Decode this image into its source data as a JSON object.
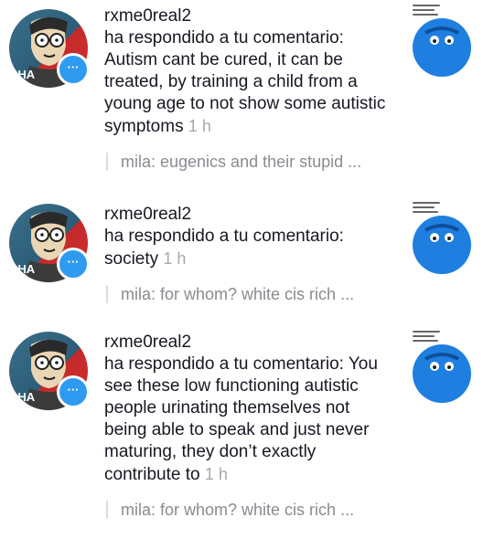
{
  "notifications": [
    {
      "username": "rxme0real2",
      "message": "ha respondido a tu comentario: Autism cant be cured, it can be treated, by training a child from a young age to not show some autistic symptoms",
      "time": "1 h",
      "reply_preview": "mila: eugenics and their stupid ...",
      "badge_icon": "comment-bubble-icon",
      "avatar_text": "CHA"
    },
    {
      "username": "rxme0real2",
      "message": "ha respondido a tu comentario: society",
      "time": "1 h",
      "reply_preview": "mila: for whom? white cis rich ...",
      "badge_icon": "comment-bubble-icon",
      "avatar_text": "CHA"
    },
    {
      "username": "rxme0real2",
      "message": "ha respondido a tu comentario: You see these low functioning autistic people urinating themselves not being able to speak and just never maturing, they don’t exactly contribute to",
      "time": "1 h",
      "reply_preview": "mila: for whom? white cis rich ...",
      "badge_icon": "comment-bubble-icon",
      "avatar_text": "CHA"
    }
  ],
  "colors": {
    "badge": "#2f9bf0",
    "text": "#161823",
    "muted": "#a7a8ad",
    "emoji_blue": "#1e7fe0"
  }
}
